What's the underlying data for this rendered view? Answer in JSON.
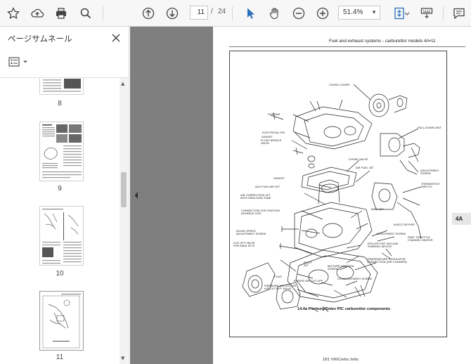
{
  "toolbar": {
    "page_current": "11",
    "page_separator": "/",
    "page_total": "24",
    "zoom": "51.4%"
  },
  "sidebar": {
    "title": "ページサムネール",
    "thumbnails": [
      {
        "label": "8"
      },
      {
        "label": "9"
      },
      {
        "label": "10"
      },
      {
        "label": "11"
      }
    ]
  },
  "document": {
    "header": "Fuel and exhaust systems - carburettor models  4A•11",
    "section_tab": "4A",
    "caption": "14.4a Pierburg/Solex PIC carburettor components",
    "footer": "1B1 VW/Cerbs Jetta"
  },
  "diagram_labels": [
    {
      "id": "choke-cover",
      "text": "CHOKE COVER"
    },
    {
      "id": "screws",
      "text": "SCREWS"
    },
    {
      "id": "electrical-pin",
      "text": "ELECTRICAL PIN"
    },
    {
      "id": "gasket-top",
      "text": "GASKET"
    },
    {
      "id": "float-needle",
      "text": "FLOAT NEEDLE\nVALVE"
    },
    {
      "id": "pull-down-unit",
      "text": "PULL-DOWN UNIT"
    },
    {
      "id": "gasket",
      "text": "GASKET"
    },
    {
      "id": "choke-valve",
      "text": "CHOKE VALVE"
    },
    {
      "id": "air-fuel-jet",
      "text": "AIR FUEL JET"
    },
    {
      "id": "adjustment-screw",
      "text": "ADJUSTMENT\nSCREW"
    },
    {
      "id": "aux-fuel-air-jet",
      "text": "AUX FUEL/AIR JET"
    },
    {
      "id": "air-correction-jet",
      "text": "AIR CORRECTION JET\nWITH EMULSION TUBE"
    },
    {
      "id": "thermostat-switch",
      "text": "THERMOSTAT\nSWITCH"
    },
    {
      "id": "main-jet",
      "text": "MAIN JET"
    },
    {
      "id": "connection-ignition",
      "text": "CONNECTION FOR IGNITION\nADVANCE UNIT"
    },
    {
      "id": "injector-pipe",
      "text": "INJECTOR PIPE"
    },
    {
      "id": "adjustment-screw-2",
      "text": "ADJUSTMENT SCREW"
    },
    {
      "id": "idling-speed",
      "text": "IDLING SPEED\nADJUSTMENT SCREW"
    },
    {
      "id": "part-throttle",
      "text": "PART THROTTLE\nCHANNEL HEATER"
    },
    {
      "id": "cut-off-valve",
      "text": "CUT-OFF VALVE\nFOR MAIN JETS"
    },
    {
      "id": "roller-vacuum",
      "text": "ROLLER FOR VACUUM\nRUNNING DEVICE"
    },
    {
      "id": "temp-regulator",
      "text": "TEMPERATURE REGULATOR\nCONNECTION (AIR CLEANER)"
    },
    {
      "id": "plug",
      "text": "PLUG"
    },
    {
      "id": "pilot-jet",
      "text": "PILOT\nJET"
    },
    {
      "id": "mixture-control",
      "text": "MIXTURE CONTROL\nSCREW"
    },
    {
      "id": "bypass-cut-off",
      "text": "BYPASS AIR CUT-OFF"
    },
    {
      "id": "co-adjustment",
      "text": "CO ADJUSTMENT SCREW"
    },
    {
      "id": "pierburg-cutter",
      "text": "PIERBURG AIR CUTTER\nAIR CUT-OFF VALVE"
    }
  ]
}
